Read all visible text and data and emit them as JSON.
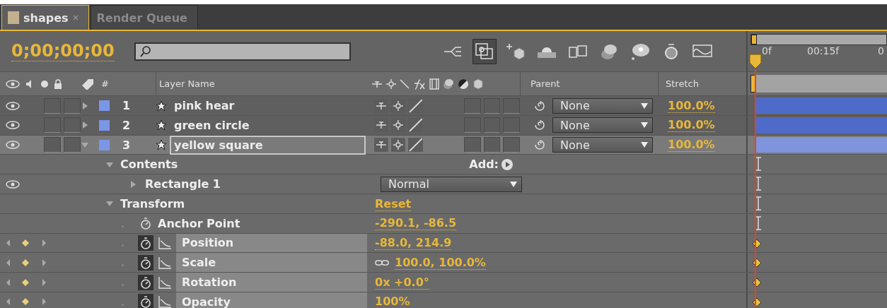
{
  "tabs": [
    {
      "label": "shapes",
      "selected": true,
      "closable": true
    },
    {
      "label": "Render Queue",
      "selected": false,
      "closable": false
    }
  ],
  "timecode": "0;00;00;00",
  "toolbar": [
    {
      "kind": "branch",
      "selected": false
    },
    {
      "kind": "frame",
      "selected": true
    },
    {
      "kind": "cube",
      "selected": false
    },
    {
      "kind": "shy",
      "selected": false
    },
    {
      "kind": "film",
      "selected": false
    },
    {
      "kind": "discs",
      "selected": false
    },
    {
      "kind": "bulb",
      "selected": false
    },
    {
      "kind": "stopwatch",
      "selected": false
    },
    {
      "kind": "graph",
      "selected": false
    }
  ],
  "columns": {
    "number": "#",
    "layer_name": "Layer Name",
    "parent": "Parent",
    "stretch": "Stretch"
  },
  "ruler": [
    "0f",
    "00:15f",
    "0"
  ],
  "layers": [
    {
      "number": "1",
      "name": "pink hear",
      "selected": false,
      "expanded": false,
      "editing": false,
      "parent": "None",
      "stretch": "100.0%"
    },
    {
      "number": "2",
      "name": "green circle",
      "selected": false,
      "expanded": false,
      "editing": false,
      "parent": "None",
      "stretch": "100.0%"
    },
    {
      "number": "3",
      "name": "yellow square",
      "selected": true,
      "expanded": true,
      "editing": true,
      "parent": "None",
      "stretch": "100.0%"
    }
  ],
  "groups": [
    {
      "name": "Contents",
      "expanded": true,
      "kind": "add",
      "action": "Add:",
      "children": [
        {
          "name": "Rectangle 1",
          "expanded": false,
          "mode": "Normal"
        }
      ]
    },
    {
      "name": "Transform",
      "expanded": true,
      "kind": "reset",
      "action": "Reset",
      "children": [
        {
          "name": "Anchor Point",
          "value": "-290.1, -86.5",
          "animated": false,
          "linked": false
        },
        {
          "name": "Position",
          "value": "-88.0, 214.9",
          "animated": true,
          "linked": false
        },
        {
          "name": "Scale",
          "value": "100.0, 100.0%",
          "animated": true,
          "linked": true
        },
        {
          "name": "Rotation",
          "value": "0x +0.0°",
          "animated": true,
          "linked": false
        },
        {
          "name": "Opacity",
          "value": "100%",
          "animated": true,
          "linked": false
        }
      ]
    }
  ]
}
